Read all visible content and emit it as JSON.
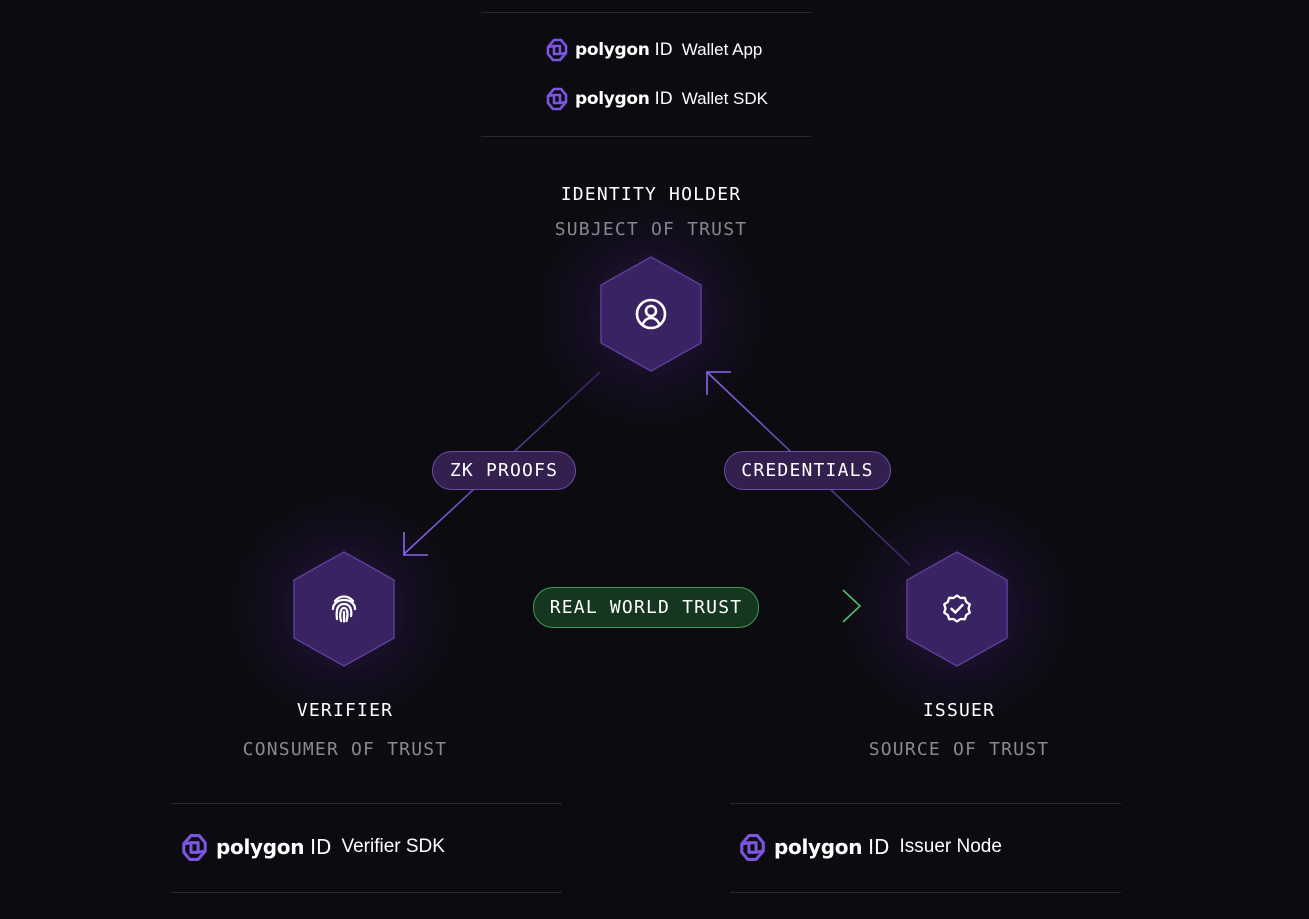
{
  "brand": {
    "name": "polygon",
    "id": "ID"
  },
  "top_products": [
    {
      "product": "Wallet App"
    },
    {
      "product": "Wallet SDK"
    }
  ],
  "identity_holder": {
    "title": "IDENTITY HOLDER",
    "subtitle": "SUBJECT OF TRUST",
    "icon": "user-circle-icon"
  },
  "verifier": {
    "title": "VERIFIER",
    "subtitle": "CONSUMER OF TRUST",
    "icon": "fingerprint-icon"
  },
  "issuer": {
    "title": "ISSUER",
    "subtitle": "SOURCE OF TRUST",
    "icon": "verified-badge-icon"
  },
  "edges": {
    "zk_proofs": "ZK PROOFS",
    "credentials": "CREDENTIALS",
    "real_world_trust": "REAL WORLD TRUST"
  },
  "bottom_products": {
    "verifier": "Verifier SDK",
    "issuer": "Issuer Node"
  },
  "colors": {
    "background": "#0c0b10",
    "hexagon_fill": "#3a2363",
    "purple_accent": "#7b55e0",
    "green_accent": "#3f9c58",
    "muted_text": "#8a8891"
  }
}
